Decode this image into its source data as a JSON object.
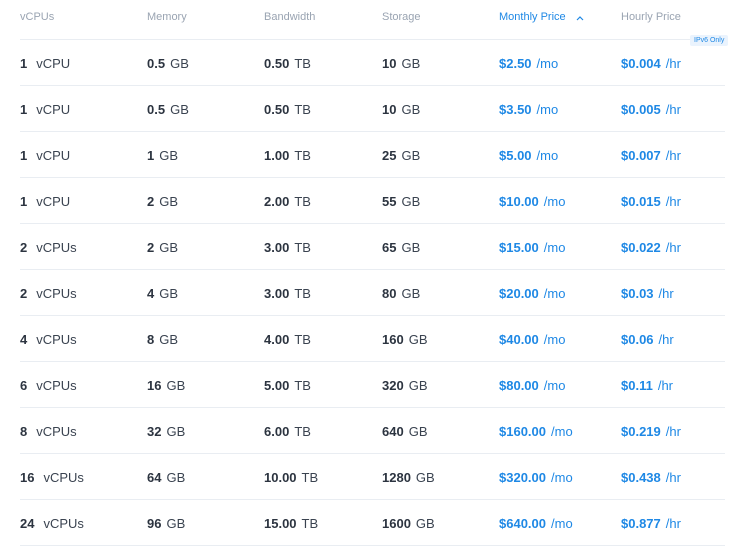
{
  "columns": {
    "vcpus": "vCPUs",
    "memory": "Memory",
    "bandwidth": "Bandwidth",
    "storage": "Storage",
    "monthly": "Monthly Price",
    "hourly": "Hourly Price"
  },
  "colors": {
    "accent": "#1e88e5",
    "text": "#2c3440",
    "muted": "#9aa4b2"
  },
  "sort_icon": "sort-chevron-up-icon",
  "badge": "IPv6 Only",
  "rows": [
    {
      "cpu": "1",
      "cpu_unit": "vCPU",
      "mem": "0.5",
      "mem_unit": "GB",
      "bw": "0.50",
      "bw_unit": "TB",
      "sto": "10",
      "sto_unit": "GB",
      "mo": "$2.50",
      "mo_unit": "/mo",
      "hr": "$0.004",
      "hr_unit": "/hr"
    },
    {
      "cpu": "1",
      "cpu_unit": "vCPU",
      "mem": "0.5",
      "mem_unit": "GB",
      "bw": "0.50",
      "bw_unit": "TB",
      "sto": "10",
      "sto_unit": "GB",
      "mo": "$3.50",
      "mo_unit": "/mo",
      "hr": "$0.005",
      "hr_unit": "/hr"
    },
    {
      "cpu": "1",
      "cpu_unit": "vCPU",
      "mem": "1",
      "mem_unit": "GB",
      "bw": "1.00",
      "bw_unit": "TB",
      "sto": "25",
      "sto_unit": "GB",
      "mo": "$5.00",
      "mo_unit": "/mo",
      "hr": "$0.007",
      "hr_unit": "/hr"
    },
    {
      "cpu": "1",
      "cpu_unit": "vCPU",
      "mem": "2",
      "mem_unit": "GB",
      "bw": "2.00",
      "bw_unit": "TB",
      "sto": "55",
      "sto_unit": "GB",
      "mo": "$10.00",
      "mo_unit": "/mo",
      "hr": "$0.015",
      "hr_unit": "/hr"
    },
    {
      "cpu": "2",
      "cpu_unit": "vCPUs",
      "mem": "2",
      "mem_unit": "GB",
      "bw": "3.00",
      "bw_unit": "TB",
      "sto": "65",
      "sto_unit": "GB",
      "mo": "$15.00",
      "mo_unit": "/mo",
      "hr": "$0.022",
      "hr_unit": "/hr"
    },
    {
      "cpu": "2",
      "cpu_unit": "vCPUs",
      "mem": "4",
      "mem_unit": "GB",
      "bw": "3.00",
      "bw_unit": "TB",
      "sto": "80",
      "sto_unit": "GB",
      "mo": "$20.00",
      "mo_unit": "/mo",
      "hr": "$0.03",
      "hr_unit": "/hr"
    },
    {
      "cpu": "4",
      "cpu_unit": "vCPUs",
      "mem": "8",
      "mem_unit": "GB",
      "bw": "4.00",
      "bw_unit": "TB",
      "sto": "160",
      "sto_unit": "GB",
      "mo": "$40.00",
      "mo_unit": "/mo",
      "hr": "$0.06",
      "hr_unit": "/hr"
    },
    {
      "cpu": "6",
      "cpu_unit": "vCPUs",
      "mem": "16",
      "mem_unit": "GB",
      "bw": "5.00",
      "bw_unit": "TB",
      "sto": "320",
      "sto_unit": "GB",
      "mo": "$80.00",
      "mo_unit": "/mo",
      "hr": "$0.11",
      "hr_unit": "/hr"
    },
    {
      "cpu": "8",
      "cpu_unit": "vCPUs",
      "mem": "32",
      "mem_unit": "GB",
      "bw": "6.00",
      "bw_unit": "TB",
      "sto": "640",
      "sto_unit": "GB",
      "mo": "$160.00",
      "mo_unit": "/mo",
      "hr": "$0.219",
      "hr_unit": "/hr"
    },
    {
      "cpu": "16",
      "cpu_unit": "vCPUs",
      "mem": "64",
      "mem_unit": "GB",
      "bw": "10.00",
      "bw_unit": "TB",
      "sto": "1280",
      "sto_unit": "GB",
      "mo": "$320.00",
      "mo_unit": "/mo",
      "hr": "$0.438",
      "hr_unit": "/hr"
    },
    {
      "cpu": "24",
      "cpu_unit": "vCPUs",
      "mem": "96",
      "mem_unit": "GB",
      "bw": "15.00",
      "bw_unit": "TB",
      "sto": "1600",
      "sto_unit": "GB",
      "mo": "$640.00",
      "mo_unit": "/mo",
      "hr": "$0.877",
      "hr_unit": "/hr"
    }
  ]
}
